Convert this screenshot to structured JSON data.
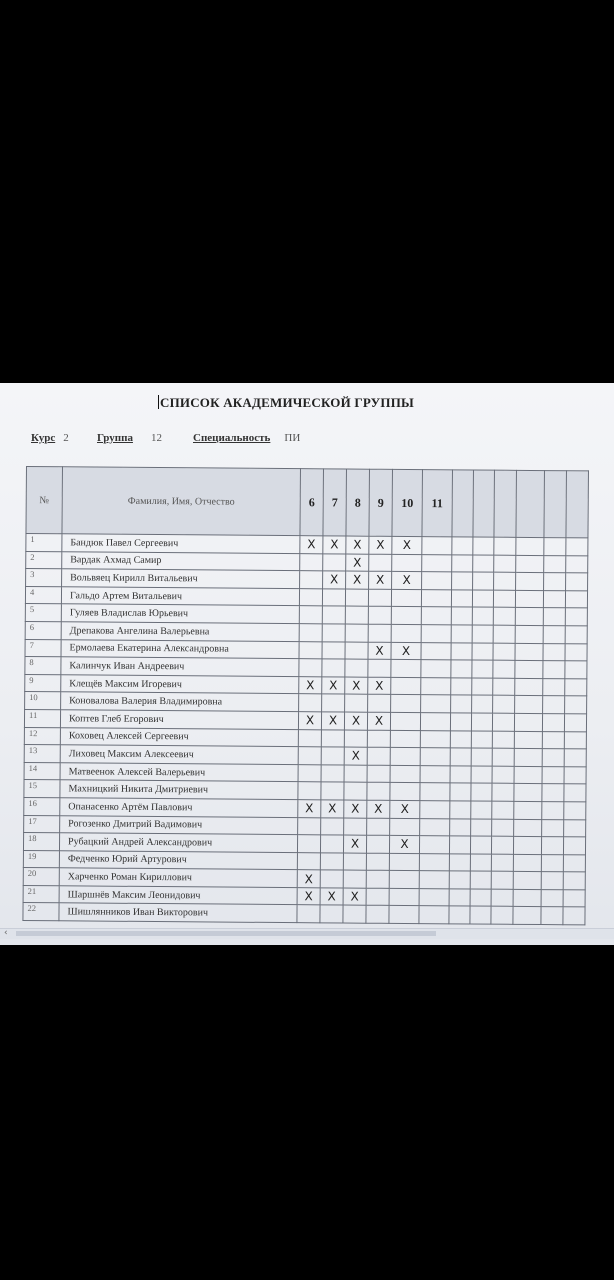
{
  "document": {
    "title": "СПИСОК АКАДЕМИЧЕСКОЙ ГРУППЫ",
    "course_label": "Курс",
    "course_value": "2",
    "group_label": "Группа",
    "group_value": "12",
    "specialty_label": "Специальность",
    "specialty_value": "ПИ"
  },
  "table": {
    "headers": {
      "number": "№",
      "name": "Фамилия, Имя, Отчество",
      "columns": [
        "6",
        "7",
        "8",
        "9",
        "10",
        "11",
        "",
        "",
        "",
        "",
        "",
        ""
      ]
    },
    "rows": [
      {
        "n": "1",
        "name": "Бандюк Павел Сергеевич",
        "marks": [
          "X",
          "X",
          "X",
          "X",
          "X",
          "",
          "",
          "",
          "",
          "",
          "",
          ""
        ]
      },
      {
        "n": "2",
        "name": "Вардак Ахмад Самир",
        "marks": [
          "",
          "",
          "X",
          "",
          "",
          "",
          "",
          "",
          "",
          "",
          "",
          ""
        ]
      },
      {
        "n": "3",
        "name": "Вольвяец Кирилл Витальевич",
        "marks": [
          "",
          "X",
          "X",
          "X",
          "X",
          "",
          "",
          "",
          "",
          "",
          "",
          ""
        ]
      },
      {
        "n": "4",
        "name": "Гальдо Артем Витальевич",
        "marks": [
          "",
          "",
          "",
          "",
          "",
          "",
          "",
          "",
          "",
          "",
          "",
          ""
        ]
      },
      {
        "n": "5",
        "name": "Гуляев Владислав Юрьевич",
        "marks": [
          "",
          "",
          "",
          "",
          "",
          "",
          "",
          "",
          "",
          "",
          "",
          ""
        ]
      },
      {
        "n": "6",
        "name": "Дрепакова Ангелина Валерьевна",
        "marks": [
          "",
          "",
          "",
          "",
          "",
          "",
          "",
          "",
          "",
          "",
          "",
          ""
        ]
      },
      {
        "n": "7",
        "name": "Ермолаева Екатерина Александровна",
        "marks": [
          "",
          "",
          "",
          "X",
          "X",
          "",
          "",
          "",
          "",
          "",
          "",
          ""
        ]
      },
      {
        "n": "8",
        "name": "Калинчук Иван Андреевич",
        "marks": [
          "",
          "",
          "",
          "",
          "",
          "",
          "",
          "",
          "",
          "",
          "",
          ""
        ]
      },
      {
        "n": "9",
        "name": "Клещёв Максим Игоревич",
        "marks": [
          "X",
          "X",
          "X",
          "X",
          "",
          "",
          "",
          "",
          "",
          "",
          "",
          ""
        ]
      },
      {
        "n": "10",
        "name": "Коновалова Валерия Владимировна",
        "marks": [
          "",
          "",
          "",
          "",
          "",
          "",
          "",
          "",
          "",
          "",
          "",
          ""
        ]
      },
      {
        "n": "11",
        "name": "Коптев Глеб Егорович",
        "marks": [
          "X",
          "X",
          "X",
          "X",
          "",
          "",
          "",
          "",
          "",
          "",
          "",
          ""
        ]
      },
      {
        "n": "12",
        "name": "Коховец Алексей Сергеевич",
        "marks": [
          "",
          "",
          "",
          "",
          "",
          "",
          "",
          "",
          "",
          "",
          "",
          ""
        ]
      },
      {
        "n": "13",
        "name": "Лиховец Максим Алексеевич",
        "marks": [
          "",
          "",
          "X",
          "",
          "",
          "",
          "",
          "",
          "",
          "",
          "",
          ""
        ]
      },
      {
        "n": "14",
        "name": "Матвеенок Алексей Валерьевич",
        "marks": [
          "",
          "",
          "",
          "",
          "",
          "",
          "",
          "",
          "",
          "",
          "",
          ""
        ]
      },
      {
        "n": "15",
        "name": "Махницкий Никита Дмитриевич",
        "marks": [
          "",
          "",
          "",
          "",
          "",
          "",
          "",
          "",
          "",
          "",
          "",
          ""
        ]
      },
      {
        "n": "16",
        "name": "Опанасенко Артём Павлович",
        "marks": [
          "X",
          "X",
          "X",
          "X",
          "X",
          "",
          "",
          "",
          "",
          "",
          "",
          ""
        ]
      },
      {
        "n": "17",
        "name": "Рогозенко Дмитрий Вадимович",
        "marks": [
          "",
          "",
          "",
          "",
          "",
          "",
          "",
          "",
          "",
          "",
          "",
          ""
        ]
      },
      {
        "n": "18",
        "name": "Рубацкий Андрей Александрович",
        "marks": [
          "",
          "",
          "X",
          "",
          "X",
          "",
          "",
          "",
          "",
          "",
          "",
          ""
        ]
      },
      {
        "n": "19",
        "name": "Федченко Юрий Артурович",
        "marks": [
          "",
          "",
          "",
          "",
          "",
          "",
          "",
          "",
          "",
          "",
          "",
          ""
        ]
      },
      {
        "n": "20",
        "name": "Харченко Роман Кириллович",
        "marks": [
          "X",
          "",
          "",
          "",
          "",
          "",
          "",
          "",
          "",
          "",
          "",
          ""
        ]
      },
      {
        "n": "21",
        "name": "Шаршнёв Максим Леонидович",
        "marks": [
          "X",
          "X",
          "X",
          "",
          "",
          "",
          "",
          "",
          "",
          "",
          "",
          ""
        ]
      },
      {
        "n": "22",
        "name": "Шишлянников Иван Викторович",
        "marks": [
          "",
          "",
          "",
          "",
          "",
          "",
          "",
          "",
          "",
          "",
          "",
          ""
        ]
      }
    ]
  },
  "ui": {
    "scroll_left_glyph": "‹"
  }
}
